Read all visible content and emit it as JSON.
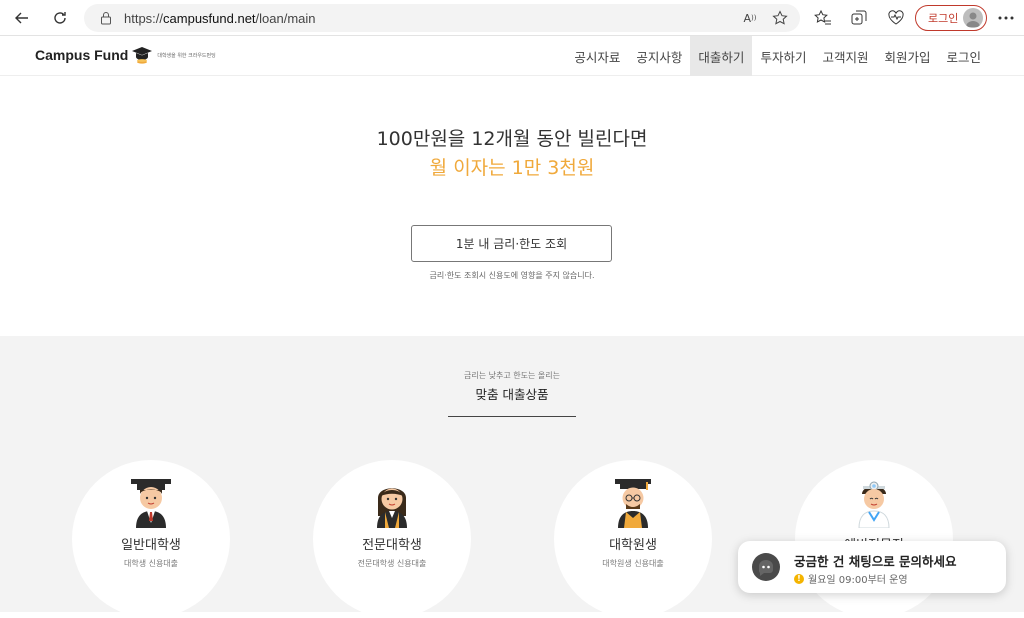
{
  "browser": {
    "url_prefix": "https://",
    "url_host": "campusfund.net",
    "url_path": "/loan/main",
    "profile_label": "로그인"
  },
  "site": {
    "logo_text": "Campus Fund",
    "logo_tagline": "대학생을 위한 크라우드펀딩",
    "menu": [
      {
        "label": "공시자료",
        "active": false
      },
      {
        "label": "공지사항",
        "active": false
      },
      {
        "label": "대출하기",
        "active": true
      },
      {
        "label": "투자하기",
        "active": false
      },
      {
        "label": "고객지원",
        "active": false
      },
      {
        "label": "회원가입",
        "active": false
      },
      {
        "label": "로그인",
        "active": false
      }
    ]
  },
  "hero": {
    "line1": "100만원을 12개월 동안 빌린다면",
    "line2": "월 이자는 1만 3천원",
    "cta_label": "1분 내 금리·한도 조회",
    "note": "금리·한도 조회시 신용도에 영향을 주지 않습니다."
  },
  "products": {
    "subtitle": "금리는 낮추고 한도는 올리는",
    "title": "맞춤 대출상품",
    "cards": [
      {
        "name": "일반대학생",
        "desc": "대학생 신용대출",
        "icon": "graduate-boy-icon"
      },
      {
        "name": "전문대학생",
        "desc": "전문대학생 신용대출",
        "icon": "graduate-girl-icon"
      },
      {
        "name": "대학원생",
        "desc": "대학원생 신용대출",
        "icon": "grad-student-icon"
      },
      {
        "name": "예비전문직",
        "desc": "",
        "icon": "doctor-icon"
      }
    ]
  },
  "chat": {
    "title": "궁금한 건 채팅으로 문의하세요",
    "status": "월요일 09:00부터 운영"
  },
  "colors": {
    "accent": "#f0a93b",
    "profile_red": "#c0392b",
    "section_bg": "#f3f3f3"
  }
}
